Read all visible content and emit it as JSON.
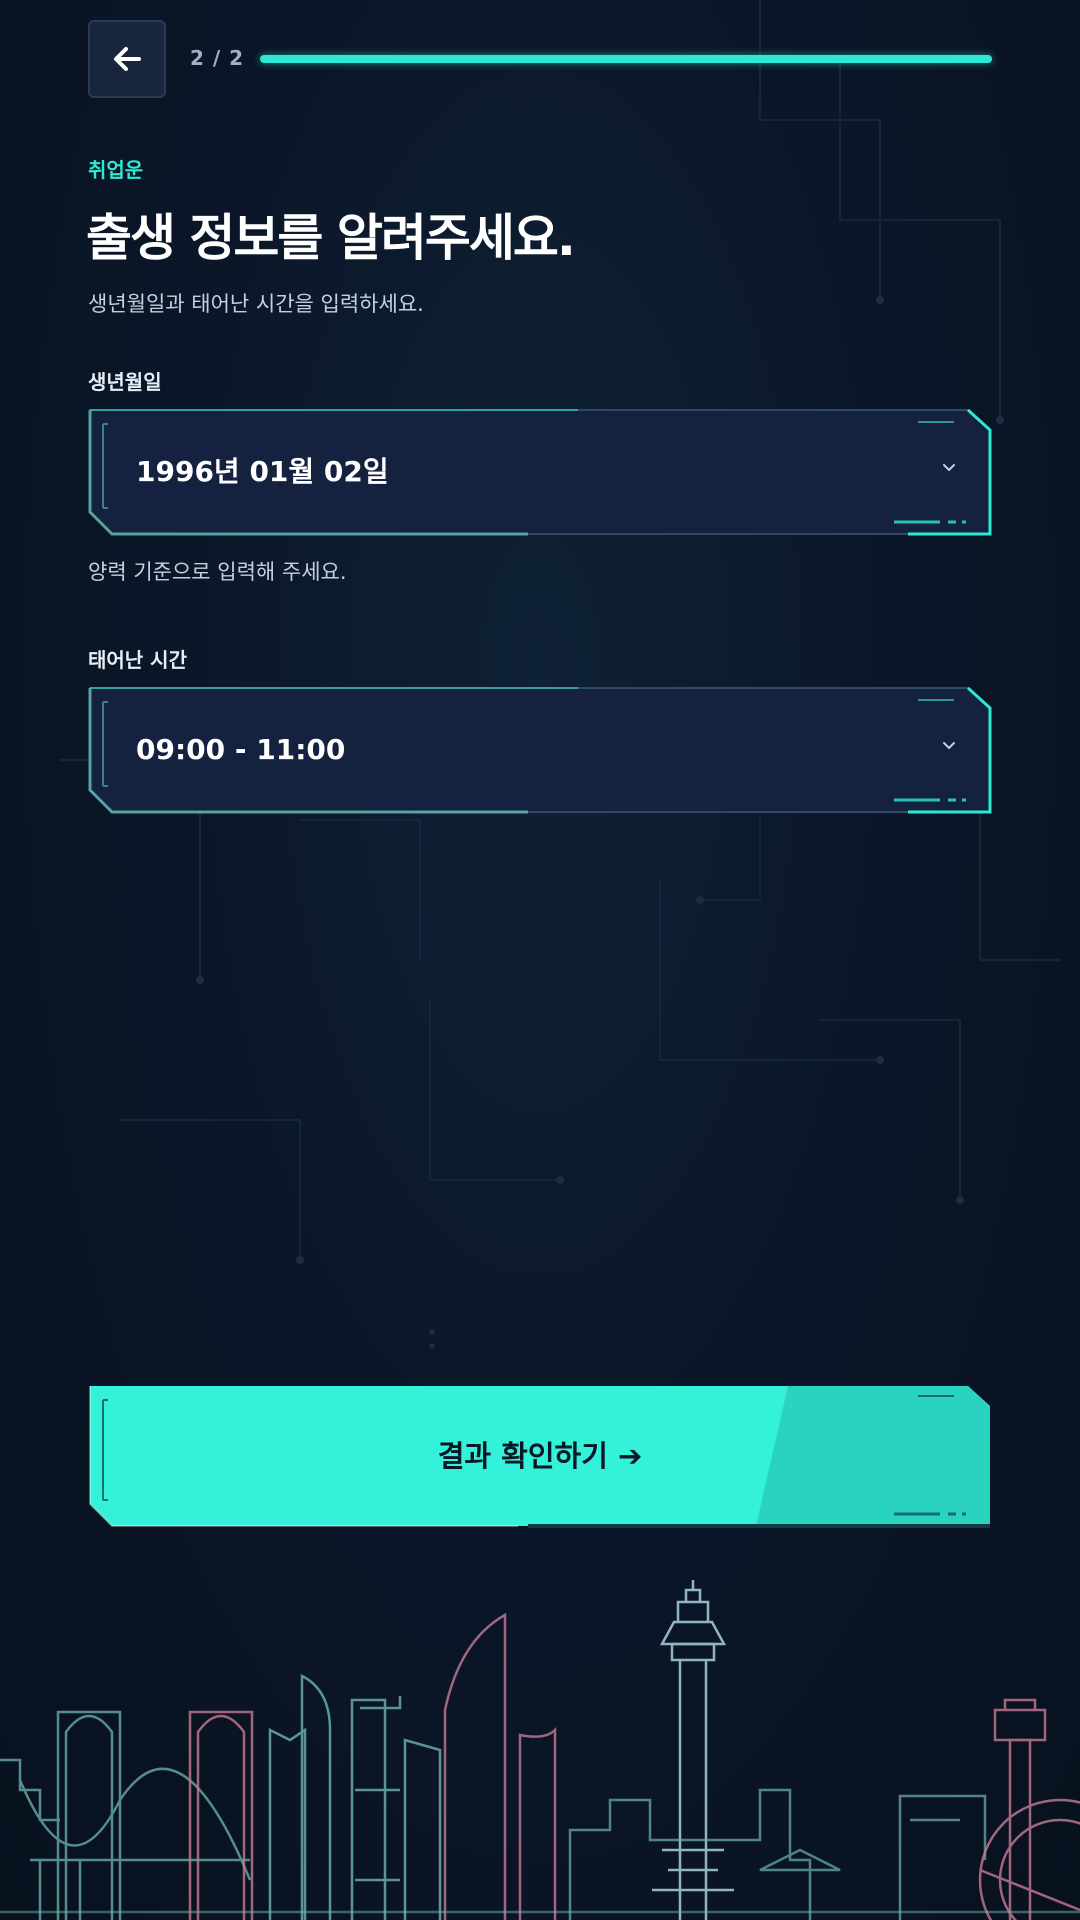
{
  "header": {
    "step_text": "2 / 2",
    "progress_fraction": 1.0
  },
  "category": "취업운",
  "title": "출생 정보를 알려주세요.",
  "subtitle": "생년월일과 태어난 시간을 입력하세요.",
  "birth_date": {
    "label": "생년월일",
    "value": "1996년 01월 02일",
    "helper": "양력 기준으로 입력해 주세요."
  },
  "birth_time": {
    "label": "태어난 시간",
    "value": "09:00 - 11:00"
  },
  "cta": {
    "label": "결과 확인하기 ➔"
  },
  "colors": {
    "accent": "#2ee8d4",
    "background": "#0b1626",
    "field_bg": "#15223f",
    "skyline_teal": "#6fb5b0",
    "skyline_pink": "#c77b93"
  },
  "icons": {
    "back": "arrow-left-icon",
    "dropdown": "chevron-down-icon",
    "skyline": "busan-skyline-illustration"
  }
}
